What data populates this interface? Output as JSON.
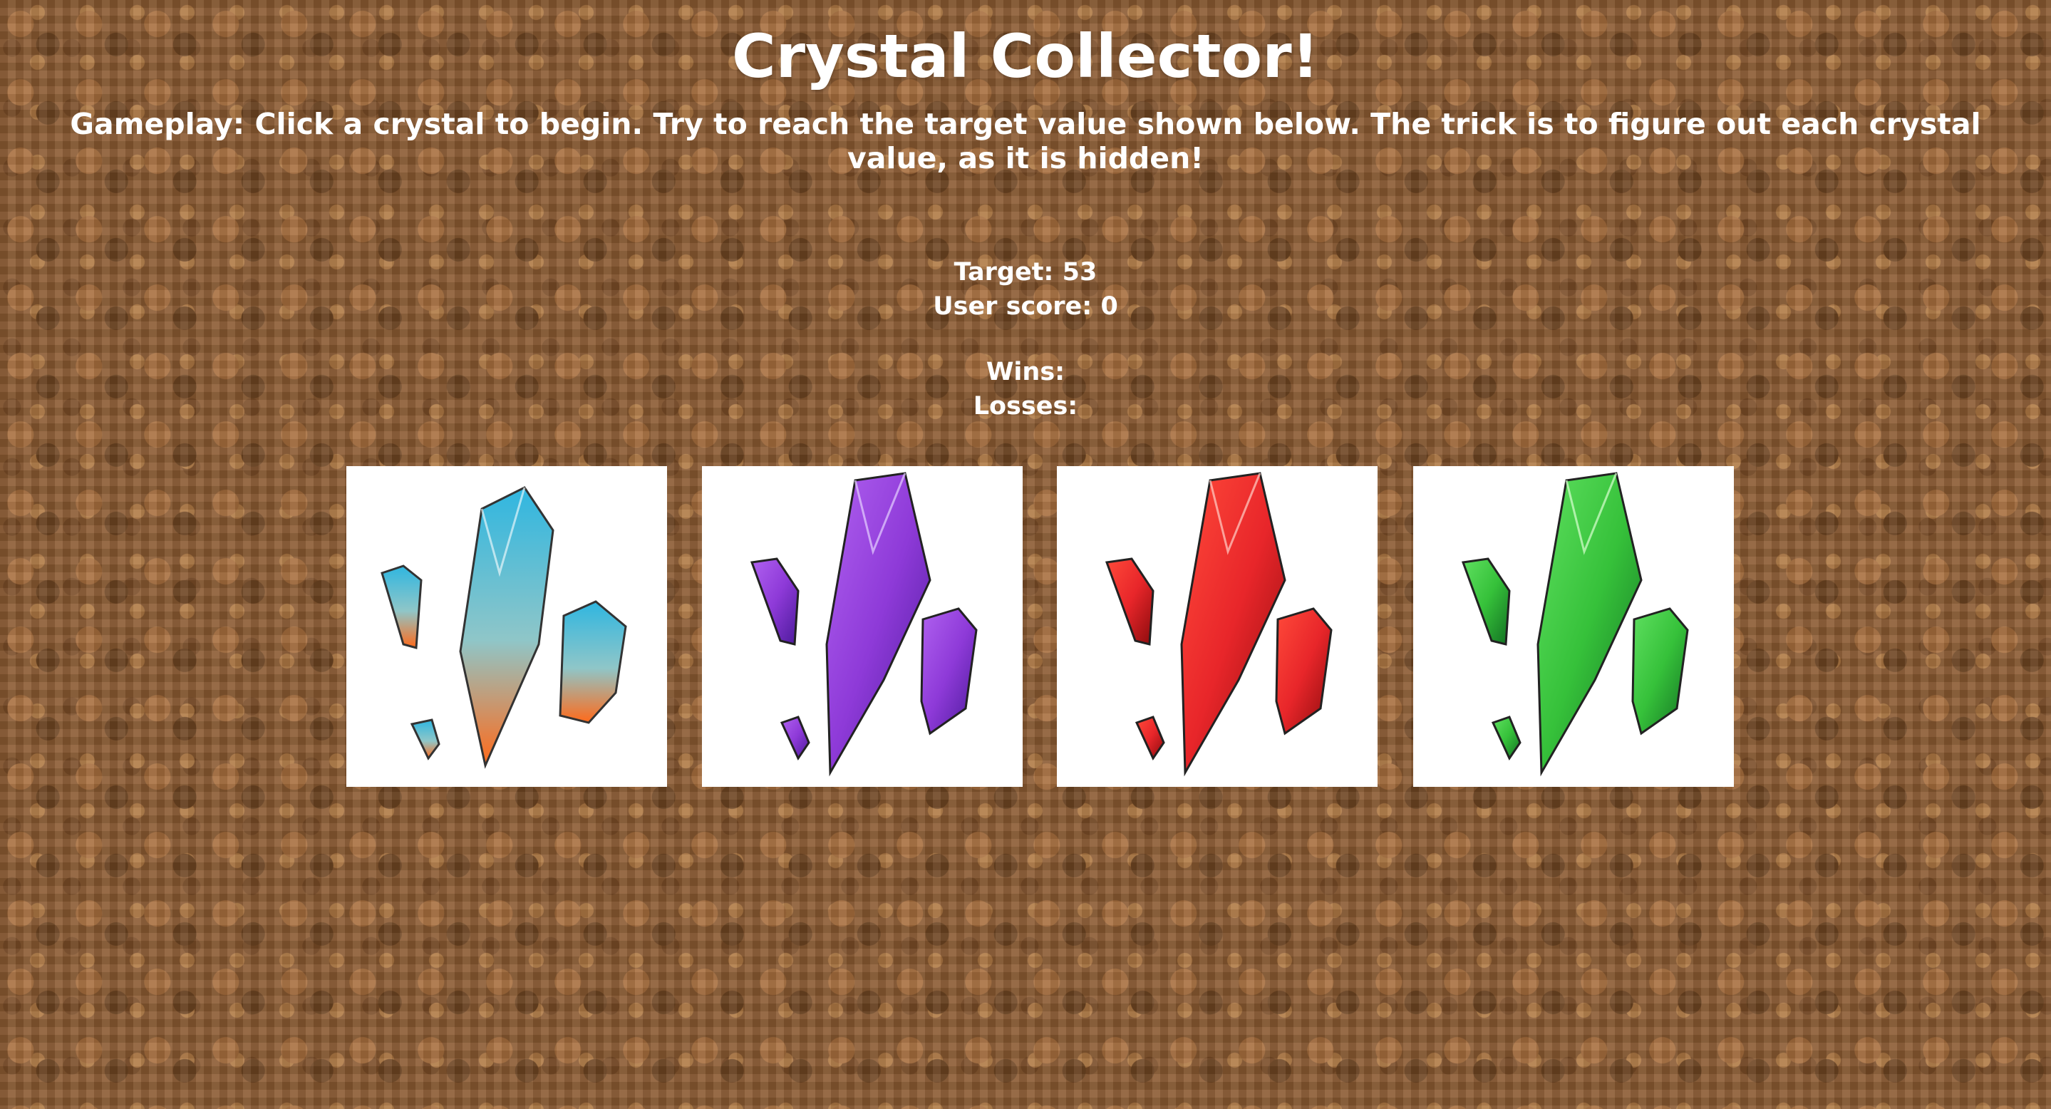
{
  "header": {
    "title": "Crystal Collector!",
    "instructions": "Gameplay: Click a crystal to begin. Try to reach the target value shown below. The trick is to figure out each crystal value, as it is hidden!"
  },
  "stats": {
    "target_label": "Target:",
    "target_value": "53",
    "score_label": "User score:",
    "score_value": "0",
    "wins_label": "Wins:",
    "wins_value": "",
    "losses_label": "Losses:",
    "losses_value": ""
  },
  "crystals": [
    {
      "icon": "blue-orange-crystal-icon",
      "colors": {
        "top": "#2fb6e0",
        "bottom": "#ff6a1a"
      }
    },
    {
      "icon": "purple-crystal-icon",
      "colors": {
        "top": "#8e3ad8",
        "bottom": "#4b1a9a"
      }
    },
    {
      "icon": "red-crystal-icon",
      "colors": {
        "top": "#e8262a",
        "bottom": "#8a0b0d"
      }
    },
    {
      "icon": "green-crystal-icon",
      "colors": {
        "top": "#36c13a",
        "bottom": "#127022"
      }
    }
  ]
}
